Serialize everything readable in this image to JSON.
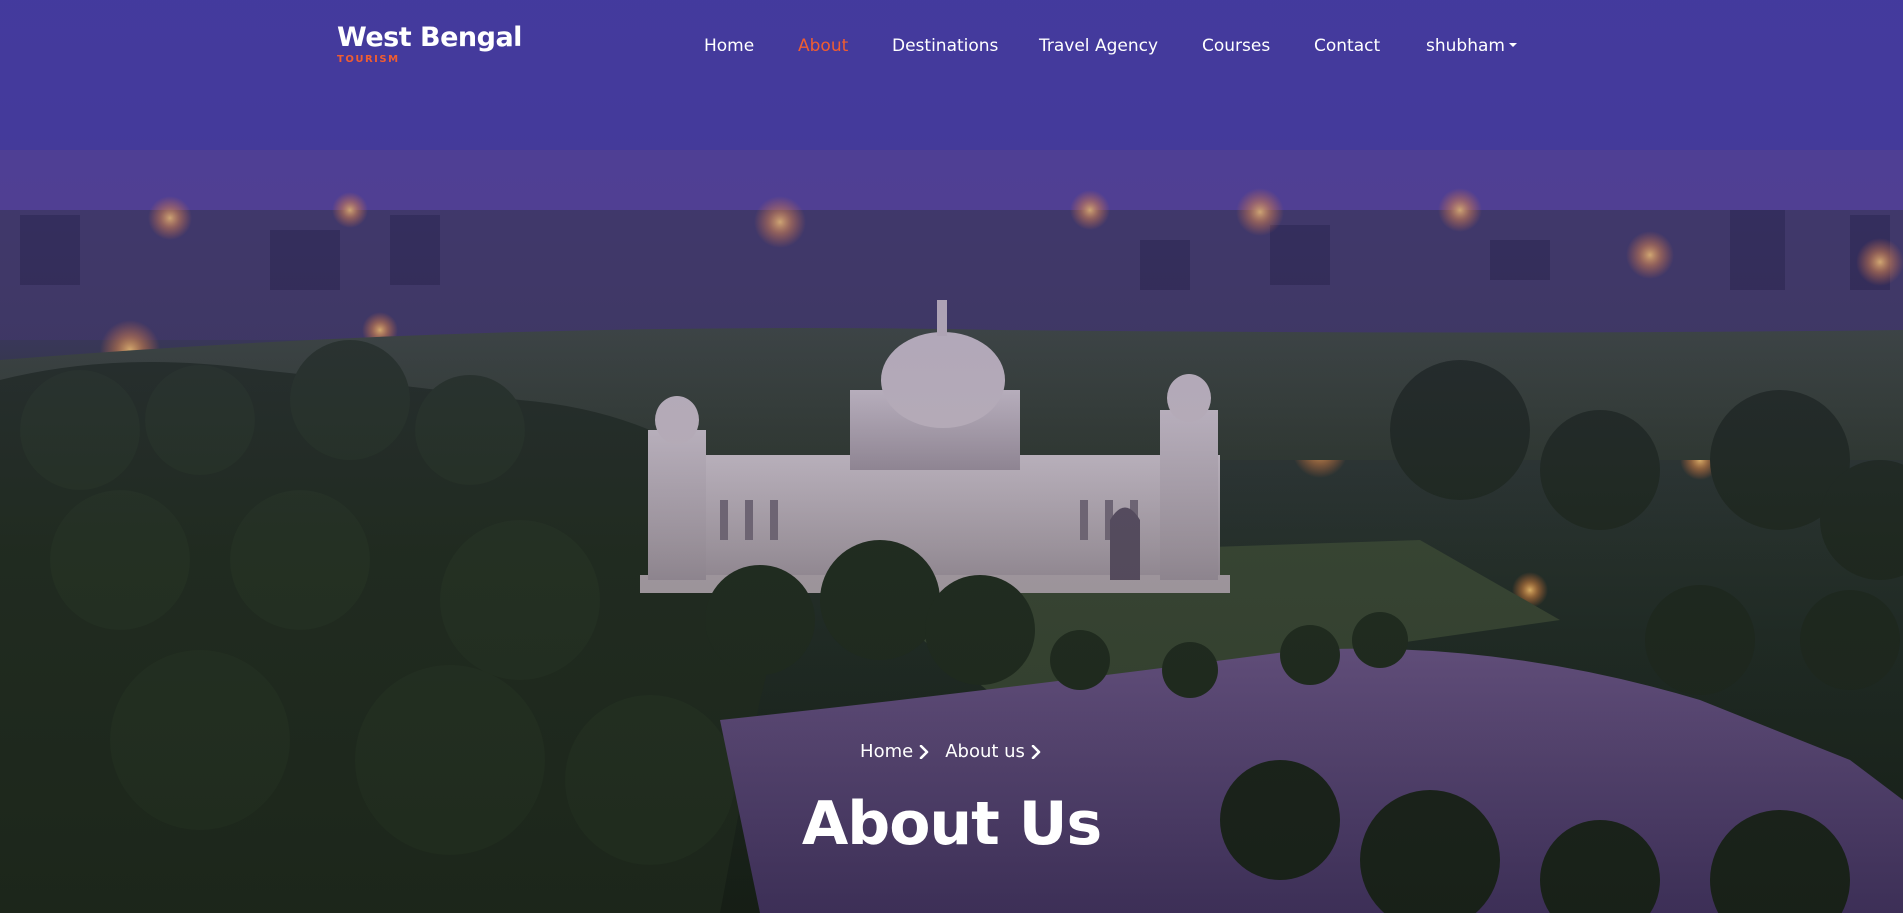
{
  "brand": {
    "name": "West Bengal",
    "tagline": "TOURISM",
    "accent_color": "#f15d30"
  },
  "nav": {
    "items": [
      {
        "label": "Home",
        "active": false
      },
      {
        "label": "About",
        "active": true
      },
      {
        "label": "Destinations",
        "active": false
      },
      {
        "label": "Travel Agency",
        "active": false
      },
      {
        "label": "Courses",
        "active": false
      },
      {
        "label": "Contact",
        "active": false
      },
      {
        "label": "shubham",
        "active": false,
        "dropdown": true
      }
    ]
  },
  "breadcrumb": {
    "items": [
      {
        "label": "Home",
        "icon": "chevron-right-icon"
      },
      {
        "label": "About us",
        "icon": "chevron-right-icon"
      }
    ]
  },
  "hero": {
    "title": "About Us",
    "background": "night aerial photo of Victoria Memorial, Kolkata"
  }
}
